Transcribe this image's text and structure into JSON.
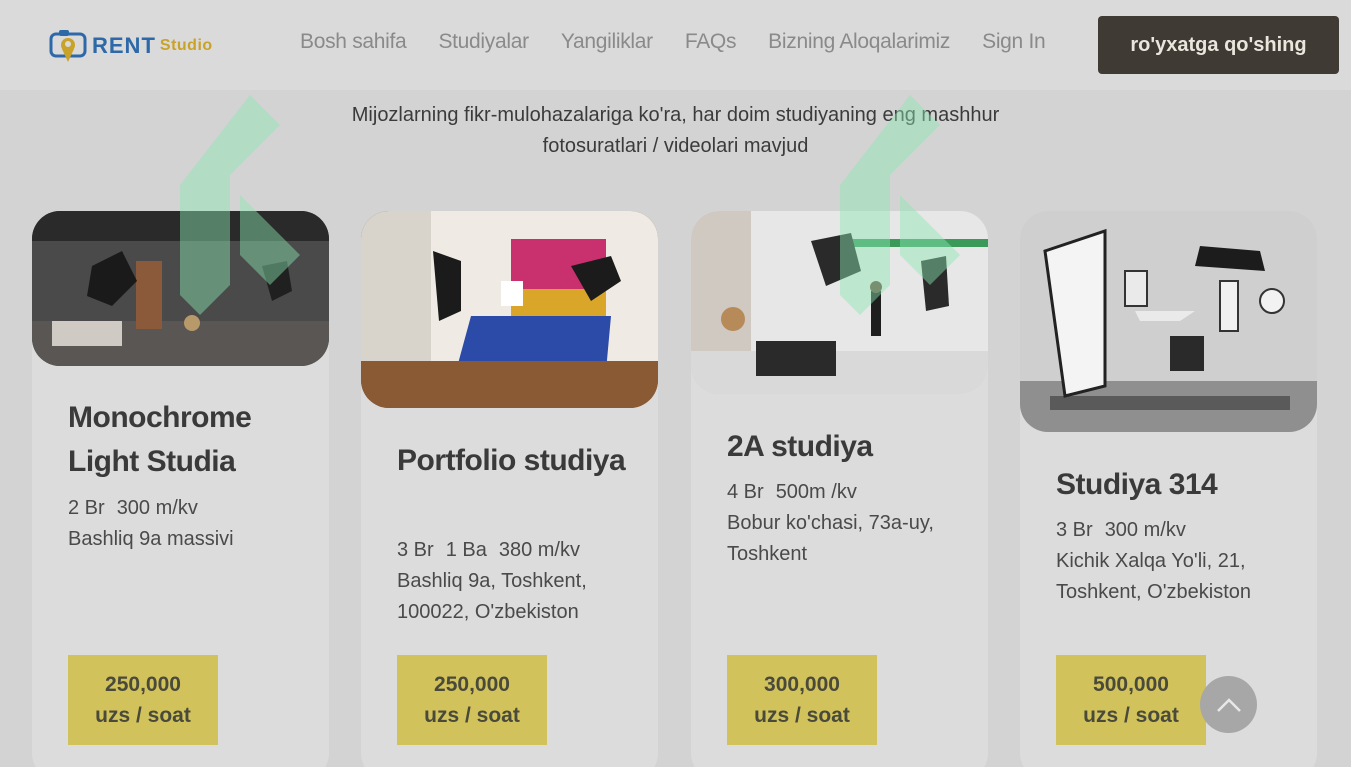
{
  "header": {
    "logo": {
      "rent": "RENT",
      "studio": "Studio"
    },
    "nav": [
      "Bosh sahifa",
      "Studiyalar",
      "Yangiliklar",
      "FAQs",
      "Bizning Aloqalarimiz",
      "Sign In"
    ],
    "cta_label": "ro'yxatga qo'shing"
  },
  "subtitle": "Mijozlarning fikr-mulohazalariga ko'ra, har doim studiyaning eng mashhur fotosuratlari / videolari mavjud",
  "cards": [
    {
      "title": "Monochrome Light Studia",
      "specs": [
        "2 Br",
        "300 m/kv"
      ],
      "address": "Bashliq 9a massivi",
      "price_amount": "250,000",
      "price_unit": "uzs / soat"
    },
    {
      "title": "Portfolio studiya",
      "specs": [
        "3 Br",
        "1 Ba",
        "380 m/kv"
      ],
      "address": "Bashliq 9a, Toshkent, 100022, O'zbekiston",
      "price_amount": "250,000",
      "price_unit": "uzs / soat"
    },
    {
      "title": "2A studiya",
      "specs": [
        "4 Br",
        "500m /kv"
      ],
      "address": "Bobur ko'chasi, 73a-uy, Toshkent",
      "price_amount": "300,000",
      "price_unit": "uzs / soat"
    },
    {
      "title": "Studiya 314",
      "specs": [
        "3 Br",
        "300 m/kv"
      ],
      "address": "Kichik Xalqa Yo'li, 21, Toshkent, O'zbekiston",
      "price_amount": "500,000",
      "price_unit": "uzs / soat"
    }
  ],
  "icons": {
    "logo": "camera-pin-icon",
    "scroll_top": "chevron-up-icon"
  },
  "colors": {
    "cta_bg": "#3f3a33",
    "price_bg": "#d2c25c",
    "logo_blue": "#2d68a8",
    "logo_gold": "#c9a22a"
  }
}
